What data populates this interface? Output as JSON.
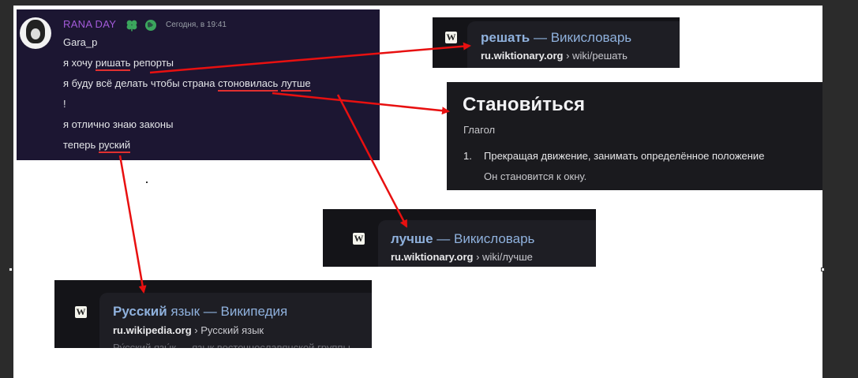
{
  "message": {
    "username": "RANA DAY",
    "timestamp": "Сегодня, в 19:41",
    "lines": {
      "l1": "Gara_p",
      "l2_pre": "я хочу ",
      "l2_err": "ришать",
      "l2_post": " репорты",
      "l3_pre": "я буду всё делать чтобы страна ",
      "l3_err1": "стоновилась",
      "l3_mid": " ",
      "l3_err2": "лутше",
      "l4": "!",
      "l5": "я отлично знаю законы",
      "l6_pre": "теперь ",
      "l6_err": "руский"
    },
    "icons": [
      "avatar",
      "clover-badge-icon",
      "globe-icon"
    ]
  },
  "cards": {
    "reshat": {
      "favicon": "W",
      "title_bold": "решать",
      "title_rest": " — Викисловарь",
      "url_domain": "ru.wiktionary.org",
      "url_path": " › wiki/решать"
    },
    "luchshe": {
      "favicon": "W",
      "title_bold": "лучше",
      "title_rest": " — Викисловарь",
      "url_domain": "ru.wiktionary.org",
      "url_path": " › wiki/лучше"
    },
    "russkiy": {
      "favicon": "W",
      "title_bold": "Русский",
      "title_rest": " язык — Википедия",
      "url_domain": "ru.wikipedia.org",
      "url_path": " › Русский язык",
      "snippet": "Ру́сский язы́к — язык восточнославянской группы"
    }
  },
  "definition": {
    "word": "Станови́ться",
    "pos": "Глагол",
    "num": "1.",
    "meaning": "Прекращая движение, занимать определённое положение",
    "example": "Он становится к окну."
  },
  "colors": {
    "arrow": "#e81010",
    "username": "#a35bd9",
    "link": "#8fb1dd"
  }
}
